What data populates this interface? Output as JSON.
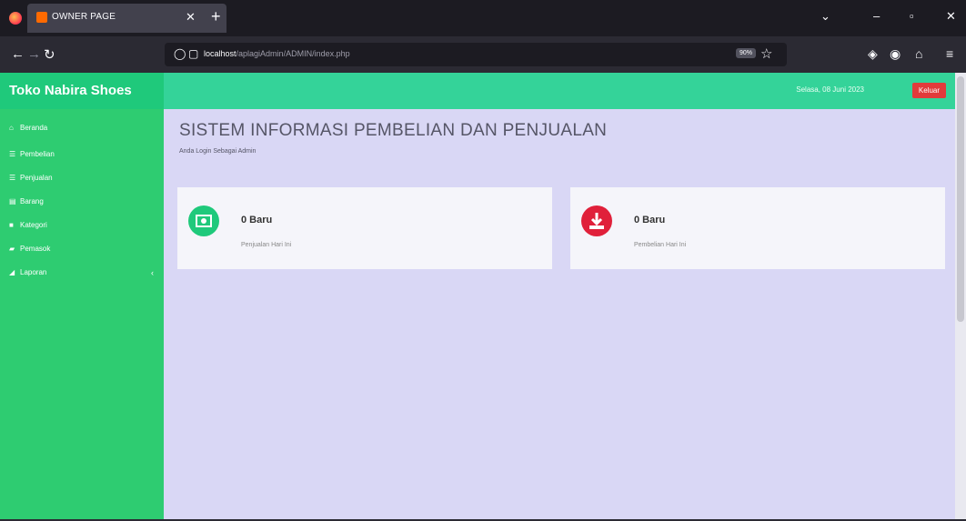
{
  "browser": {
    "tab_title": "OWNER PAGE",
    "url_host": "localhost",
    "url_path": "/aplagiAdmin/ADMIN/index.php",
    "zoom": "90%"
  },
  "app": {
    "brand": "Toko Nabira Shoes",
    "date": "Selasa, 08 Juni 2023",
    "logout_label": "Keluar",
    "accent_green": "#2ecc71",
    "topbar_green": "#34d399",
    "logout_red": "#e23b3b"
  },
  "sidebar": {
    "items": [
      {
        "label": "Beranda",
        "icon": "home-icon"
      },
      {
        "label": "Pembelian",
        "icon": "list-icon"
      },
      {
        "label": "Penjualan",
        "icon": "list-icon"
      },
      {
        "label": "Barang",
        "icon": "box-icon"
      },
      {
        "label": "Kategori",
        "icon": "tag-icon"
      },
      {
        "label": "Pemasok",
        "icon": "truck-icon"
      },
      {
        "label": "Laporan",
        "icon": "report-icon"
      }
    ]
  },
  "main": {
    "title": "SISTEM INFORMASI PEMBELIAN DAN PENJUALAN",
    "subtitle": "Anda Login Sebagai Admin",
    "cards": [
      {
        "value": "0 Baru",
        "label": "Penjualan Hari Ini",
        "icon": "money-icon",
        "color": "#1fc97b"
      },
      {
        "value": "0 Baru",
        "label": "Pembelian Hari Ini",
        "icon": "download-icon",
        "color": "#e0203a"
      }
    ]
  }
}
